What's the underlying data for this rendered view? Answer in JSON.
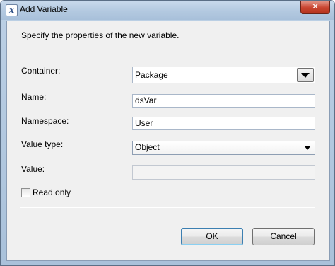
{
  "window": {
    "title": "Add Variable",
    "close_glyph": "✕"
  },
  "dialog": {
    "description": "Specify the properties of the new variable.",
    "fields": {
      "container": {
        "label": "Container:",
        "value": "Package"
      },
      "name": {
        "label": "Name:",
        "value": "dsVar"
      },
      "namespace": {
        "label": "Namespace:",
        "value": "User"
      },
      "value_type": {
        "label": "Value type:",
        "value": "Object"
      },
      "value": {
        "label": "Value:",
        "value": ""
      }
    },
    "read_only": {
      "label": "Read only",
      "checked": false
    },
    "buttons": {
      "ok": "OK",
      "cancel": "Cancel"
    }
  }
}
